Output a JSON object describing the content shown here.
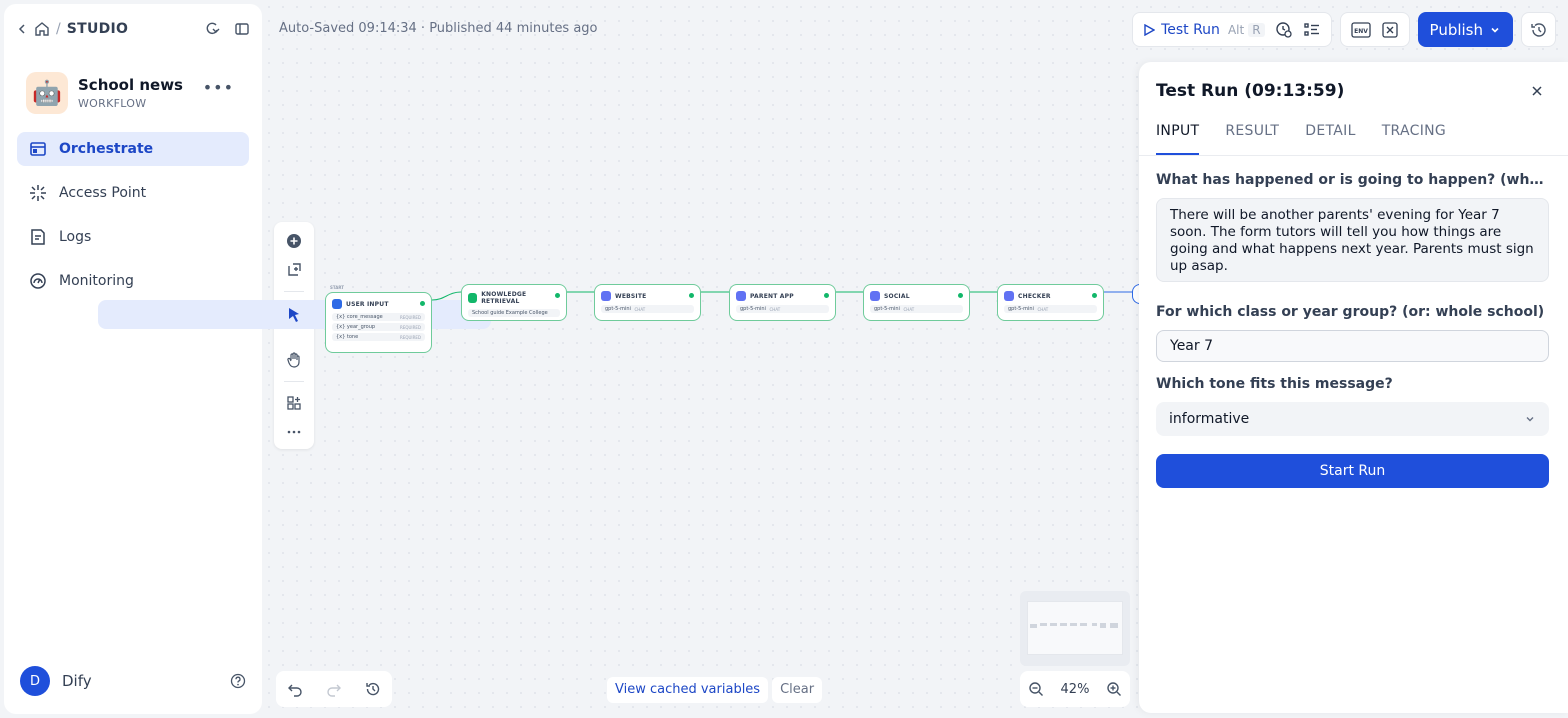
{
  "sidebar": {
    "breadcrumb": "STUDIO",
    "app_name": "School news",
    "app_type": "WORKFLOW",
    "app_emoji": "🤖",
    "menu": [
      {
        "label": "Orchestrate"
      },
      {
        "label": "Access Point"
      },
      {
        "label": "Logs"
      },
      {
        "label": "Monitoring"
      }
    ],
    "user_initial": "D",
    "user_name": "Dify"
  },
  "header": {
    "autosave": "Auto-Saved 09:14:34 · Published 44 minutes ago",
    "test_run": "Test Run",
    "shortcut_mod": "Alt",
    "shortcut_key": "R",
    "publish": "Publish"
  },
  "canvas": {
    "start_label": "START",
    "nodes": [
      {
        "title": "USER INPUT",
        "color": "#2e6ae6"
      },
      {
        "title": "KNOWLEDGE RETRIEVAL",
        "color": "#12b76a",
        "detail": "School guide Example College"
      },
      {
        "title": "WEBSITE",
        "color": "#6172f3",
        "model": "gpt-5-mini",
        "tag": "CHAT"
      },
      {
        "title": "PARENT APP",
        "color": "#6172f3",
        "model": "gpt-5-mini",
        "tag": "CHAT"
      },
      {
        "title": "SOCIAL",
        "color": "#6172f3",
        "model": "gpt-5-mini",
        "tag": "CHAT"
      },
      {
        "title": "CHECKER",
        "color": "#6172f3",
        "model": "gpt-5-mini",
        "tag": "CHAT"
      }
    ],
    "vars": [
      {
        "name": "{x} core_message",
        "req": "REQUIRED"
      },
      {
        "name": "{x} year_group",
        "req": "REQUIRED"
      },
      {
        "name": "{x} tone",
        "req": "REQUIRED"
      }
    ],
    "view_cached": "View cached variables",
    "clear": "Clear",
    "zoom": "42%"
  },
  "panel": {
    "title": "Test Run (09:13:59)",
    "tabs": [
      "INPUT",
      "RESULT",
      "DETAIL",
      "TRACING"
    ],
    "q1_label": "What has happened or is going to happen? (who, what...",
    "q1_value": "There will be another parents' evening for Year 7 soon. The form tutors will tell you how things are going and what happens next year. Parents must sign up asap.",
    "q2_label": "For which class or year group? (or: whole school)",
    "q2_value": "Year 7",
    "q3_label": "Which tone fits this message?",
    "q3_value": "informative",
    "start_run": "Start Run"
  }
}
